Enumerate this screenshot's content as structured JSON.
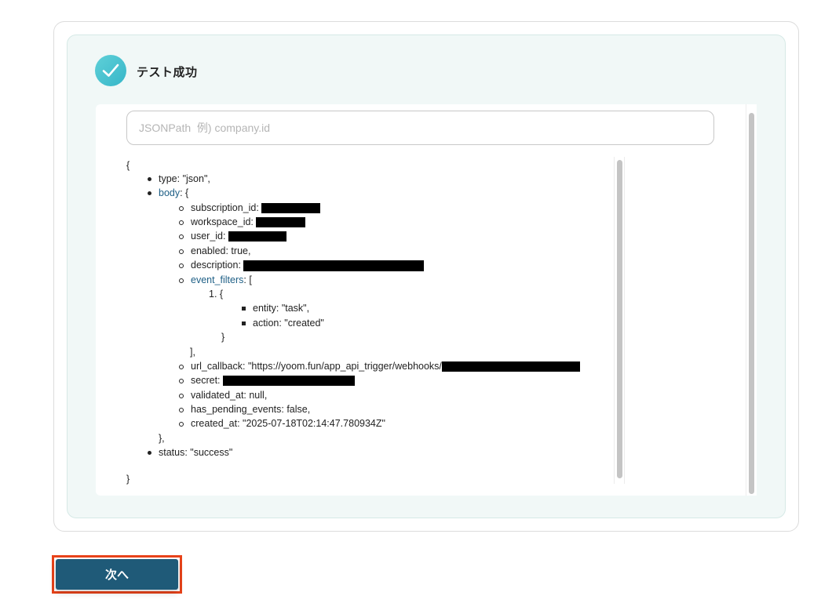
{
  "status": {
    "title": "テスト成功",
    "icon": "check-circle-icon",
    "icon_color": "#3fbdd0"
  },
  "jsonpath": {
    "placeholder": "JSONPath  例) company.id",
    "value": ""
  },
  "json_tree": {
    "open_brace": "{",
    "close_brace": "}",
    "type_line": "type: \"json\",",
    "body_key": "body",
    "body_open": ": {",
    "subscription_id_key": "subscription_id:",
    "workspace_id_key": "workspace_id:",
    "user_id_key": "user_id:",
    "enabled_line": "enabled: true,",
    "description_key": "description:",
    "event_filters_key": "event_filters",
    "event_filters_open": ": [",
    "filter_index": "1.",
    "filter_open": "{",
    "entity_line": "entity: \"task\",",
    "action_line": "action: \"created\"",
    "filter_close": "}",
    "array_close": "],",
    "url_callback_line": "url_callback: \"https://yoom.fun/app_api_trigger/webhooks/",
    "secret_key": "secret:",
    "validated_at_line": "validated_at: null,",
    "has_pending_events_line": "has_pending_events: false,",
    "created_at_line": "created_at: \"2025-07-18T02:14:47.780934Z\"",
    "body_close": "},",
    "status_line": "status: \"success\"",
    "link_color": "#1e5f86"
  },
  "next_button": {
    "label": "次へ",
    "color": "#1f5a78",
    "highlight_color": "#e8431a"
  }
}
